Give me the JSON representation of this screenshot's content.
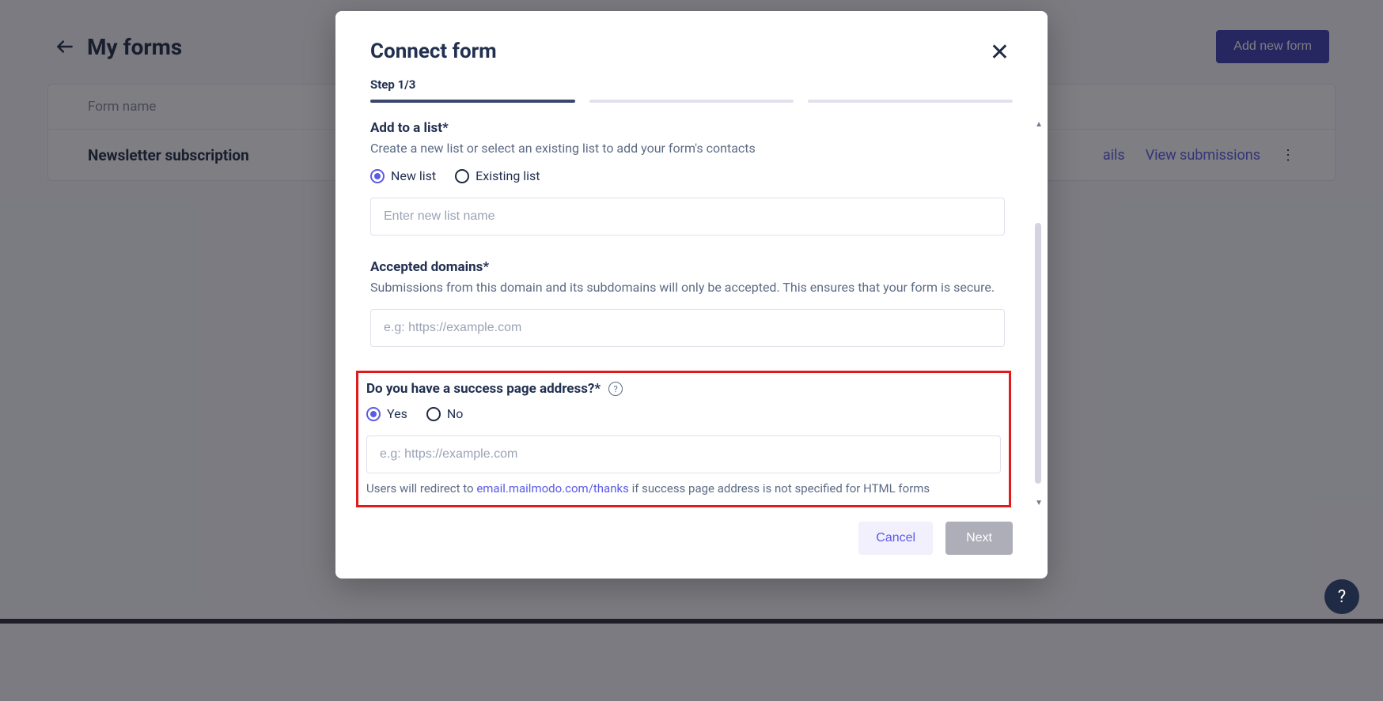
{
  "page": {
    "title": "My forms",
    "add_button": "Add new form"
  },
  "table": {
    "header_label": "Form name",
    "row_name": "Newsletter subscription",
    "action_details": "ails",
    "action_submissions": "View submissions"
  },
  "modal": {
    "title": "Connect form",
    "step_label": "Step 1/3",
    "add_list": {
      "title": "Add to a list*",
      "desc": "Create a new list or select an existing list to add your form's contacts",
      "radio_new": "New list",
      "radio_existing": "Existing list",
      "placeholder": "Enter new list name",
      "value": ""
    },
    "domains": {
      "title": "Accepted domains*",
      "desc": "Submissions from this domain and its subdomains will only be accepted. This ensures that your form is secure.",
      "placeholder": "e.g: https://example.com",
      "value": ""
    },
    "success": {
      "title": "Do you have a success page address?*",
      "radio_yes": "Yes",
      "radio_no": "No",
      "placeholder": "e.g: https://example.com",
      "value": "",
      "hint_prefix": "Users will redirect to ",
      "hint_link": "email.mailmodo.com/thanks",
      "hint_suffix": " if success page address is not specified for HTML forms"
    },
    "footer": {
      "cancel": "Cancel",
      "next": "Next"
    }
  },
  "fab": "?"
}
